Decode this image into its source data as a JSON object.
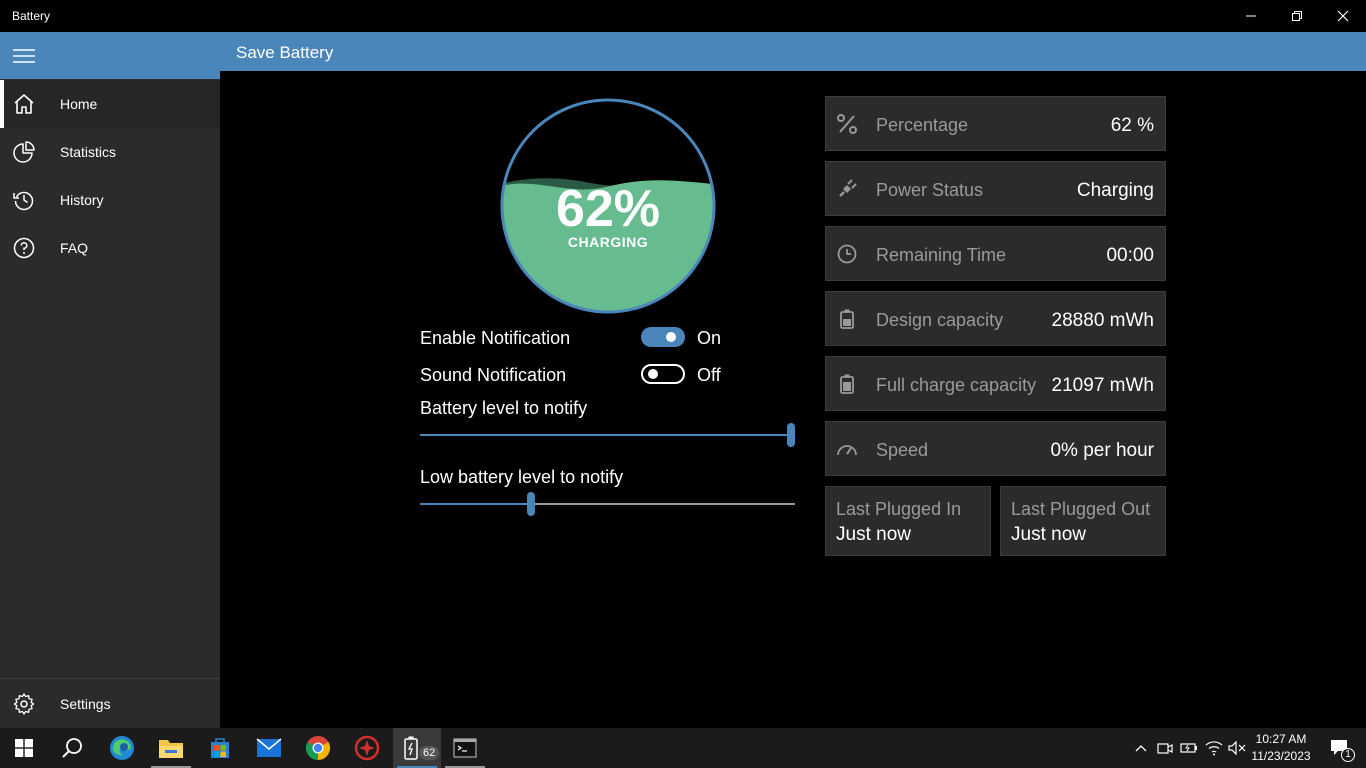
{
  "window": {
    "title": "Battery"
  },
  "header": {
    "title": "Save Battery"
  },
  "sidebar": {
    "items": [
      {
        "label": "Home",
        "icon": "home-icon"
      },
      {
        "label": "Statistics",
        "icon": "pie-chart-icon"
      },
      {
        "label": "History",
        "icon": "history-icon"
      },
      {
        "label": "FAQ",
        "icon": "help-icon"
      }
    ],
    "settings_label": "Settings"
  },
  "gauge": {
    "percent_text": "62%",
    "status": "CHARGING",
    "level": 0.62,
    "fill_color": "#66bb8f"
  },
  "notifications": {
    "enable_label": "Enable Notification",
    "enable_state": "On",
    "sound_label": "Sound Notification",
    "sound_state": "Off",
    "battery_level_label": "Battery level to notify",
    "battery_level_value": 1.0,
    "low_battery_label": "Low battery level to notify",
    "low_battery_value": 0.3
  },
  "cards": [
    {
      "label": "Percentage",
      "value": "62 %",
      "icon": "percent-icon"
    },
    {
      "label": "Power Status",
      "value": "Charging",
      "icon": "plug-icon"
    },
    {
      "label": "Remaining Time",
      "value": "00:00",
      "icon": "clock-icon"
    },
    {
      "label": "Design capacity",
      "value": "28880 mWh",
      "icon": "battery-icon"
    },
    {
      "label": "Full charge capacity",
      "value": "21097 mWh",
      "icon": "battery-full-icon"
    },
    {
      "label": "Speed",
      "value": "0% per hour",
      "icon": "speedometer-icon"
    }
  ],
  "plugged": {
    "in_label": "Last Plugged In",
    "in_value": "Just now",
    "out_label": "Last Plugged Out",
    "out_value": "Just now"
  },
  "taskbar": {
    "battery_badge": "62",
    "time": "10:27 AM",
    "date": "11/23/2023",
    "notification_count": "1"
  },
  "colors": {
    "accent": "#4a86ba",
    "sidebar": "#2b2b2b",
    "card": "#2b2b2b"
  }
}
